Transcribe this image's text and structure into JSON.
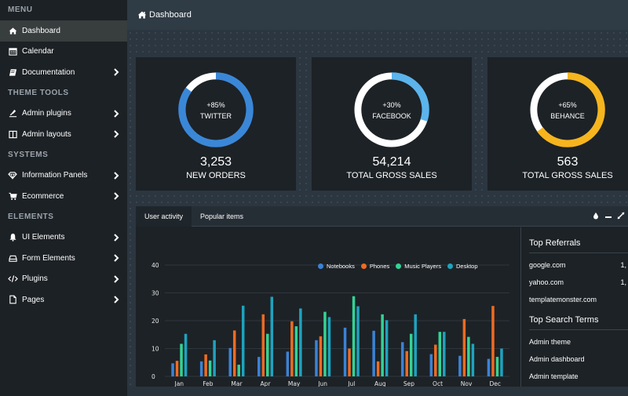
{
  "sidebar": {
    "sections": [
      {
        "title": "MENU",
        "items": [
          {
            "label": "Dashboard",
            "icon": "home-icon",
            "active": true,
            "has_submenu": false
          },
          {
            "label": "Calendar",
            "icon": "calendar-icon",
            "active": false,
            "has_submenu": false
          },
          {
            "label": "Documentation",
            "icon": "book-icon",
            "active": false,
            "has_submenu": true
          }
        ]
      },
      {
        "title": "THEME TOOLS",
        "items": [
          {
            "label": "Admin plugins",
            "icon": "eyedropper-icon",
            "active": false,
            "has_submenu": true
          },
          {
            "label": "Admin layouts",
            "icon": "columns-icon",
            "active": false,
            "has_submenu": true
          }
        ]
      },
      {
        "title": "SYSTEMS",
        "items": [
          {
            "label": "Information Panels",
            "icon": "diamond-icon",
            "active": false,
            "has_submenu": true
          },
          {
            "label": "Ecommerce",
            "icon": "cart-icon",
            "active": false,
            "has_submenu": true
          }
        ]
      },
      {
        "title": "ELEMENTS",
        "items": [
          {
            "label": "UI Elements",
            "icon": "bell-icon",
            "active": false,
            "has_submenu": true
          },
          {
            "label": "Form Elements",
            "icon": "hdd-icon",
            "active": false,
            "has_submenu": true
          },
          {
            "label": "Plugins",
            "icon": "code-icon",
            "active": false,
            "has_submenu": true
          },
          {
            "label": "Pages",
            "icon": "file-icon",
            "active": false,
            "has_submenu": true
          }
        ]
      }
    ]
  },
  "header": {
    "title": "Dashboard",
    "icon": "home-icon"
  },
  "stats": [
    {
      "percent_label": "+85%",
      "network": "TWITTER",
      "value": "3,253",
      "label": "NEW ORDERS",
      "fill_fraction": 0.85,
      "color": "#3a87d8"
    },
    {
      "percent_label": "+30%",
      "network": "FACEBOOK",
      "value": "54,214",
      "label": "TOTAL GROSS SALES",
      "fill_fraction": 0.3,
      "color": "#5bb4ec"
    },
    {
      "percent_label": "+65%",
      "network": "BEHANCE",
      "value": "563",
      "label": "TOTAL GROSS SALES",
      "fill_fraction": 0.65,
      "color": "#f6b51e"
    }
  ],
  "panel": {
    "tabs": [
      {
        "label": "User activity",
        "active": true
      },
      {
        "label": "Popular items",
        "active": false
      }
    ],
    "tools": [
      "color-drop-icon",
      "minimize-icon",
      "expand-icon"
    ]
  },
  "chart_data": {
    "type": "bar",
    "title": "",
    "xlabel": "",
    "ylabel": "",
    "categories": [
      "Jan",
      "Feb",
      "Mar",
      "Apr",
      "May",
      "Jun",
      "Jul",
      "Aug",
      "Sep",
      "Oct",
      "Nov",
      "Dec"
    ],
    "series": [
      {
        "name": "Notebooks",
        "color": "#3b82d6",
        "values": [
          4.7,
          5.4,
          10.2,
          7,
          8.9,
          13,
          17.5,
          16.4,
          12.3,
          8,
          7.4,
          6.3
        ]
      },
      {
        "name": "Phones",
        "color": "#ee6b22",
        "values": [
          5.6,
          7.9,
          16.5,
          22.3,
          19.8,
          14.4,
          10,
          5.4,
          9.1,
          11.4,
          20.6,
          25.3
        ]
      },
      {
        "name": "Music Players",
        "color": "#33d394",
        "values": [
          11.7,
          5.7,
          4.2,
          15.3,
          18,
          23.2,
          28.8,
          22.3,
          15.3,
          16,
          14.2,
          7
        ]
      },
      {
        "name": "Desktop",
        "color": "#1ea3be",
        "values": [
          15.3,
          13,
          25.4,
          28.6,
          24.4,
          21.3,
          25.2,
          20.2,
          22.3,
          16,
          11.7,
          10
        ]
      }
    ],
    "yticks": [
      0,
      10,
      20,
      30,
      40
    ],
    "ylim": [
      0,
      40
    ],
    "grid": true,
    "legend_position": "top-right"
  },
  "side_list": {
    "referrals_title": "Top Referrals",
    "referrals": [
      {
        "site": "google.com",
        "count": "1,"
      },
      {
        "site": "yahoo.com",
        "count": "1,"
      },
      {
        "site": "templatemonster.com",
        "count": ""
      }
    ],
    "search_title": "Top Search Terms",
    "search_terms": [
      "Admin theme",
      "Admin dashboard",
      "Admin template"
    ]
  }
}
